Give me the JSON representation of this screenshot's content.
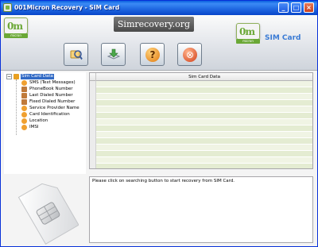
{
  "window": {
    "title": "001Micron Recovery - SIM Card",
    "minimize_glyph": "_",
    "maximize_glyph": "□",
    "close_glyph": "×"
  },
  "header": {
    "left_logo": {
      "mark": "0m",
      "brand": "micron"
    },
    "site_banner": "Simrecovery.org",
    "right_logo": {
      "mark": "0m",
      "brand": "micron"
    },
    "section_title": "SIM Card"
  },
  "toolbar": {
    "buttons": [
      {
        "icon": "magnifier-search-icon",
        "color": "#e8a23a"
      },
      {
        "icon": "save-download-icon",
        "color": "#4aa84a"
      },
      {
        "icon": "help-icon",
        "color": "#f0a02a",
        "glyph": "?"
      },
      {
        "icon": "exit-icon",
        "color": "#e2552a",
        "glyph": "⊗"
      }
    ]
  },
  "tree": {
    "expander_glyph": "−",
    "root": "Sim Card Data",
    "items": [
      "SMS (Text Messages)",
      "PhoneBook Number",
      "Last Dialed Number",
      "Fixed Dialed Number",
      "Service Provider Name",
      "Card Identification",
      "Location",
      "IMSI"
    ]
  },
  "grid": {
    "column_header": "Sim Card Data",
    "row_count": 14
  },
  "message": "Please click on searching button to start recovery from SIM Card.",
  "colors": {
    "title_bar": "#0a5fde",
    "accent_blue": "#3a7bd5",
    "grid_row_even": "#f0f4e4",
    "grid_row_odd": "#e4ecd2"
  }
}
